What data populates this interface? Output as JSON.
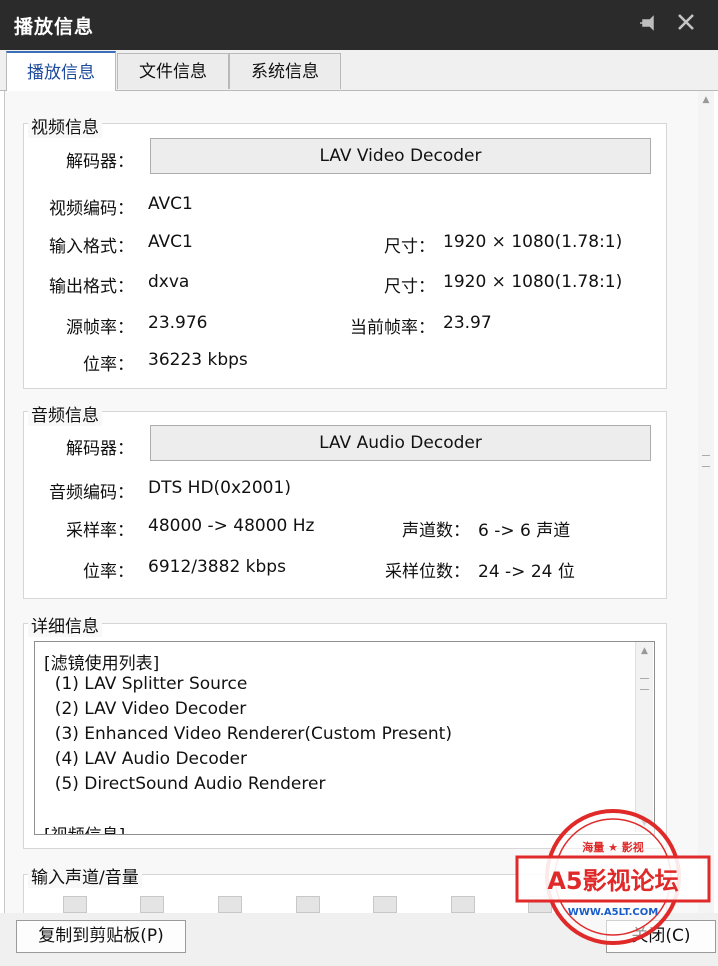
{
  "window": {
    "title": "播放信息",
    "pin_icon": "pin-icon",
    "close_icon": "close-icon"
  },
  "tabs": [
    {
      "label": "播放信息",
      "active": true
    },
    {
      "label": "文件信息",
      "active": false
    },
    {
      "label": "系统信息",
      "active": false
    }
  ],
  "video": {
    "title": "视频信息",
    "decoder_label": "解码器：",
    "decoder_value": "LAV Video Decoder",
    "codec_label": "视频编码：",
    "codec_value": "AVC1",
    "input_format_label": "输入格式：",
    "input_format_value": "AVC1",
    "input_size_label": "尺寸：",
    "input_size_value": "1920 × 1080(1.78:1)",
    "output_format_label": "输出格式：",
    "output_format_value": "dxva",
    "output_size_label": "尺寸：",
    "output_size_value": "1920 × 1080(1.78:1)",
    "source_fps_label": "源帧率：",
    "source_fps_value": "23.976",
    "current_fps_label": "当前帧率：",
    "current_fps_value": "23.97",
    "bitrate_label": "位率：",
    "bitrate_value": "36223 kbps"
  },
  "audio": {
    "title": "音频信息",
    "decoder_label": "解码器：",
    "decoder_value": "LAV Audio Decoder",
    "codec_label": "音频编码：",
    "codec_value": "DTS HD(0x2001)",
    "samplerate_label": "采样率：",
    "samplerate_value": "48000 -> 48000 Hz",
    "channels_label": "声道数：",
    "channels_value": "6 -> 6 声道",
    "bitrate_label": "位率：",
    "bitrate_value": "6912/3882 kbps",
    "bitdepth_label": "采样位数：",
    "bitdepth_value": "24 -> 24 位"
  },
  "details": {
    "title": "详细信息",
    "lines": [
      "[滤镜使用列表]",
      "  (1) LAV Splitter Source",
      "  (2) LAV Video Decoder",
      "  (3) Enhanced Video Renderer(Custom Present)",
      "  (4) LAV Audio Decoder",
      "  (5) DirectSound Audio Renderer",
      "",
      "[视频信息]"
    ]
  },
  "volume": {
    "title": "输入声道/音量"
  },
  "buttons": {
    "copy": "复制到剪贴板(P)",
    "close": "关闭(C)"
  },
  "watermark": {
    "top": "海量 ★ 影视",
    "main": "A5影视论坛",
    "url": "WWW.A5LT.COM"
  },
  "colors": {
    "titlebar": "#2b2b2b",
    "active_tab_text": "#1c4a9c",
    "stamp_red": "#e02a2a"
  }
}
